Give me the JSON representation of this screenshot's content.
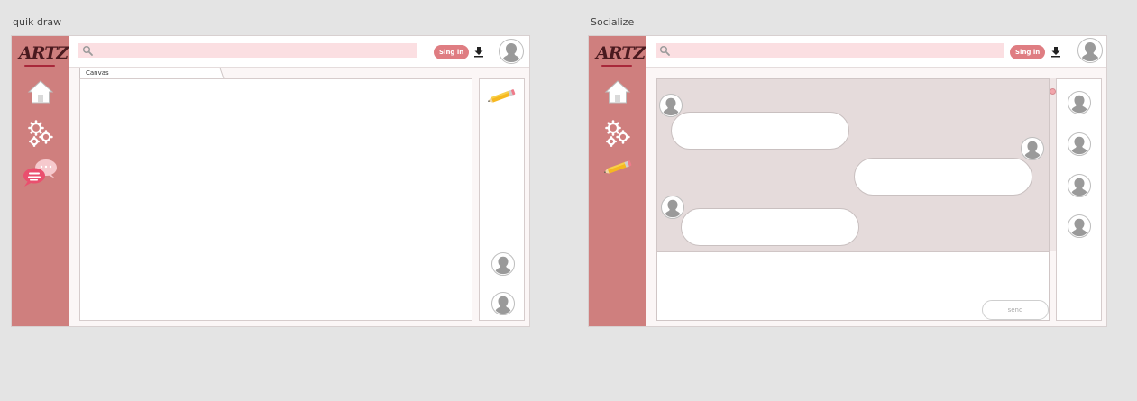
{
  "frames": [
    {
      "title": "quik draw",
      "logo": "ARTZY",
      "search_placeholder": "",
      "signin_label": "Sing in",
      "canvas_tab_label": "Canvas"
    },
    {
      "title": "Socialize",
      "logo": "ARTZY",
      "search_placeholder": "",
      "signin_label": "Sing in",
      "send_label": "send"
    }
  ],
  "colors": {
    "sidebar": "#cf7f7e",
    "search_bar": "#fbdfe2",
    "signin_button": "#df7d82",
    "chat_background": "#e5dbdb",
    "page_background": "#e4e4e4"
  },
  "icons": [
    "search-icon",
    "download-icon",
    "home-icon",
    "gears-icon",
    "chat-icon",
    "pencil-icon",
    "avatar-icon"
  ]
}
